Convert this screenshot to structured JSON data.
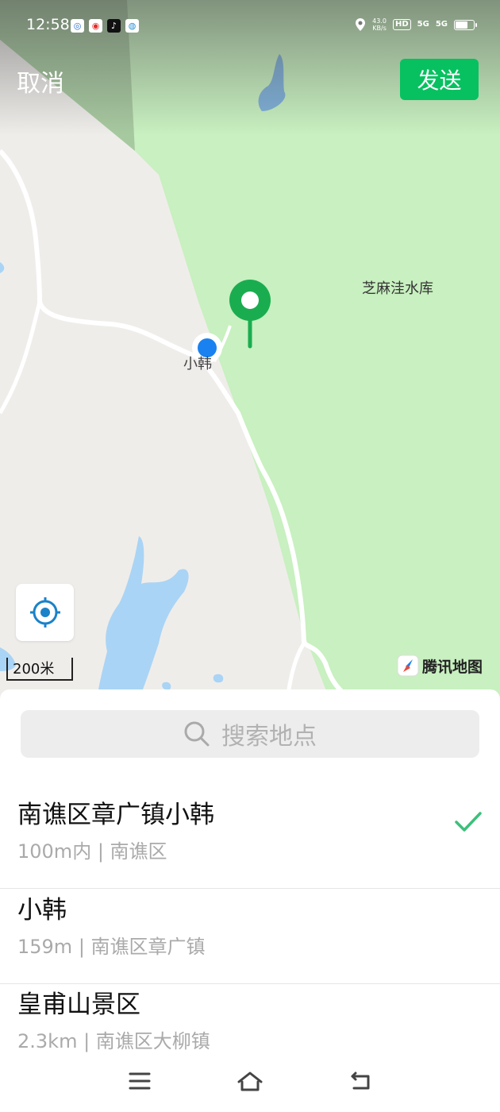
{
  "status_bar": {
    "time": "12:58",
    "net_speed_value": "43.0",
    "net_speed_unit": "KB/s",
    "hd_label": "HD",
    "sim1": "5G",
    "sim2": "5G"
  },
  "header": {
    "cancel_label": "取消",
    "send_label": "发送"
  },
  "map": {
    "poi_label": "芝麻洼水库",
    "place_label": "小韩",
    "scale_label": "200米",
    "brand_label": "腾讯地图"
  },
  "search": {
    "placeholder": "搜索地点"
  },
  "results": [
    {
      "title": "南谯区章广镇小韩",
      "subtitle": "100m内 | 南谯区",
      "selected": true
    },
    {
      "title": "小韩",
      "subtitle": "159m | 南谯区章广镇",
      "selected": false
    },
    {
      "title": "皇甫山景区",
      "subtitle": "2.3km | 南谯区大柳镇",
      "selected": false
    }
  ],
  "colors": {
    "accent_green": "#07c160",
    "pin_green": "#1aad50",
    "user_dot": "#1a82f0",
    "map_green": "#c8f0c0",
    "water": "#a9d4f5"
  },
  "icons": [
    "search-icon",
    "location-target-icon",
    "check-icon",
    "menu-icon",
    "home-icon",
    "back-icon",
    "map-pin-icon"
  ]
}
